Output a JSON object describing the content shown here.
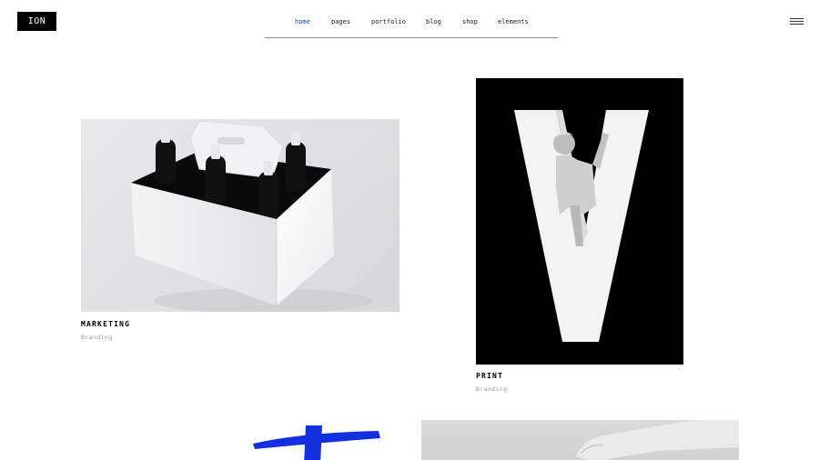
{
  "logo": {
    "text": "ION"
  },
  "nav": {
    "items": [
      {
        "label": "home",
        "active": true
      },
      {
        "label": "pages",
        "active": false
      },
      {
        "label": "portfolio",
        "active": false
      },
      {
        "label": "blog",
        "active": false
      },
      {
        "label": "shop",
        "active": false
      },
      {
        "label": "elements",
        "active": false
      }
    ]
  },
  "header": {
    "menu_icon": "hamburger-icon"
  },
  "portfolio": {
    "items": [
      {
        "title": "MARKETING",
        "category": "Branding",
        "image": "six-pack-bottles-carrier-photo"
      },
      {
        "title": "PRINT",
        "category": "Branding",
        "image": "woman-in-letter-v-photo"
      },
      {
        "image": "blue-cross-brush-stroke"
      },
      {
        "image": "hand-photo"
      }
    ]
  },
  "colors": {
    "accent": "#1a3bd6",
    "text": "#111111",
    "muted": "#9a9a9a",
    "background": "#ffffff",
    "cross": "#1230e0"
  }
}
